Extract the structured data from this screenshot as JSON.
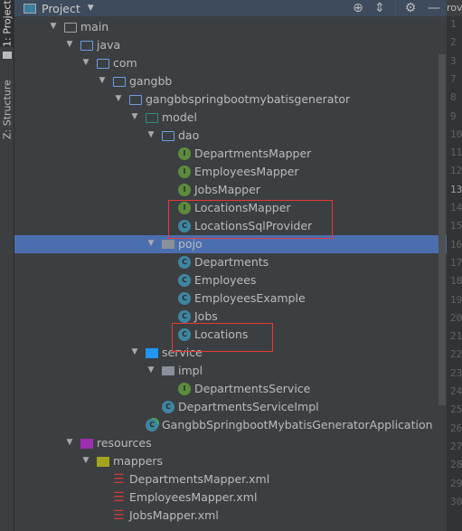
{
  "sidebar_tabs": [
    {
      "label": "1: Project",
      "active": true
    },
    {
      "label": "Z: Structure",
      "active": false
    }
  ],
  "header": {
    "title": "Project",
    "icons": [
      "locate-icon",
      "collapse-all-icon",
      "gear-icon",
      "minimize-icon"
    ]
  },
  "editor_tab_fragment": "rov",
  "tree": [
    {
      "depth": 0,
      "expanded": true,
      "icon": "folder-gray",
      "label": "main"
    },
    {
      "depth": 1,
      "expanded": true,
      "icon": "folder-source",
      "label": "java"
    },
    {
      "depth": 2,
      "expanded": true,
      "icon": "folder",
      "label": "com"
    },
    {
      "depth": 3,
      "expanded": true,
      "icon": "folder",
      "label": "gangbb"
    },
    {
      "depth": 4,
      "expanded": true,
      "icon": "folder",
      "label": "gangbbspringbootmybatisgenerator"
    },
    {
      "depth": 5,
      "expanded": true,
      "icon": "folder-model",
      "label": "model"
    },
    {
      "depth": 6,
      "expanded": true,
      "icon": "folder",
      "label": "dao"
    },
    {
      "depth": 7,
      "icon": "interface",
      "label": "DepartmentsMapper"
    },
    {
      "depth": 7,
      "icon": "interface",
      "label": "EmployeesMapper"
    },
    {
      "depth": 7,
      "icon": "interface",
      "label": "JobsMapper"
    },
    {
      "depth": 7,
      "icon": "interface",
      "label": "LocationsMapper"
    },
    {
      "depth": 7,
      "icon": "class",
      "label": "LocationsSqlProvider"
    },
    {
      "depth": 6,
      "expanded": true,
      "icon": "package",
      "label": "pojo",
      "selected": true
    },
    {
      "depth": 7,
      "icon": "class",
      "label": "Departments"
    },
    {
      "depth": 7,
      "icon": "class",
      "label": "Employees"
    },
    {
      "depth": 7,
      "icon": "class",
      "label": "EmployeesExample"
    },
    {
      "depth": 7,
      "icon": "class",
      "label": "Jobs"
    },
    {
      "depth": 7,
      "icon": "class",
      "label": "Locations"
    },
    {
      "depth": 5,
      "expanded": true,
      "icon": "folder-service",
      "label": "service"
    },
    {
      "depth": 6,
      "expanded": true,
      "icon": "package",
      "label": "impl"
    },
    {
      "depth": 7,
      "icon": "interface",
      "label": "DepartmentsService"
    },
    {
      "depth": 6,
      "icon": "class",
      "label": "DepartmentsServiceImpl"
    },
    {
      "depth": 5,
      "icon": "spring-boot-class",
      "label": "GangbbSpringbootMybatisGeneratorApplication"
    },
    {
      "depth": 1,
      "expanded": true,
      "icon": "folder-resources",
      "label": "resources"
    },
    {
      "depth": 2,
      "expanded": true,
      "icon": "folder-mappers",
      "label": "mappers"
    },
    {
      "depth": 3,
      "icon": "xml",
      "label": "DepartmentsMapper.xml"
    },
    {
      "depth": 3,
      "icon": "xml",
      "label": "EmployeesMapper.xml"
    },
    {
      "depth": 3,
      "icon": "xml",
      "label": "JobsMapper.xml"
    }
  ],
  "line_numbers": [
    "1",
    "2",
    "3",
    "7",
    "8",
    "9",
    "10",
    "11",
    "12",
    "13",
    "14",
    "15",
    "16",
    "17",
    "18",
    "19",
    "20",
    "21",
    "22",
    "23",
    "24",
    "25",
    "26",
    "27",
    "28",
    "29",
    "30"
  ],
  "current_line": "13",
  "colors": {
    "selection": "#4b6eaf",
    "highlight_box": "#e53935",
    "interface": "#5d8b3c",
    "class": "#3e86a0"
  }
}
